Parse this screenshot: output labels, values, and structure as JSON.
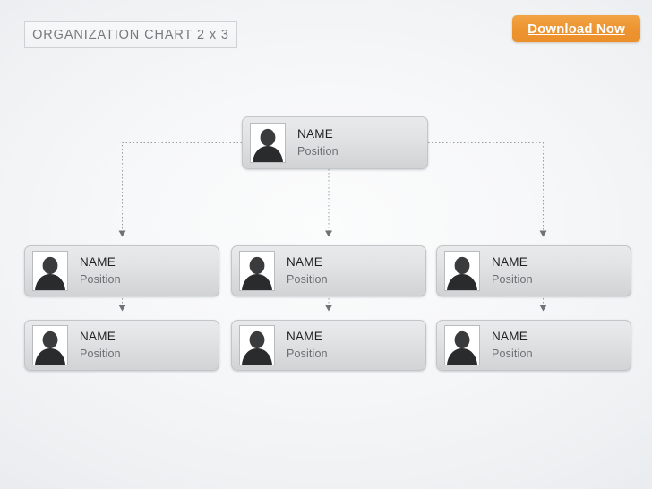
{
  "title": {
    "text": "ORGANIZATION CHART 2 x 3"
  },
  "download": {
    "label": "Download Now",
    "color": "#ed9431"
  },
  "chart": {
    "name_label": "NAME",
    "position_label": "Position",
    "avatar_icon": "person-silhouette-icon",
    "connector_color": "#9a9da1",
    "card_border_color": "#c3c5c8",
    "nodes": {
      "root": {
        "name": "NAME",
        "position": "Position"
      },
      "row2": [
        {
          "name": "NAME",
          "position": "Position"
        },
        {
          "name": "NAME",
          "position": "Position"
        },
        {
          "name": "NAME",
          "position": "Position"
        }
      ],
      "row3": [
        {
          "name": "NAME",
          "position": "Position"
        },
        {
          "name": "NAME",
          "position": "Position"
        },
        {
          "name": "NAME",
          "position": "Position"
        }
      ]
    }
  }
}
